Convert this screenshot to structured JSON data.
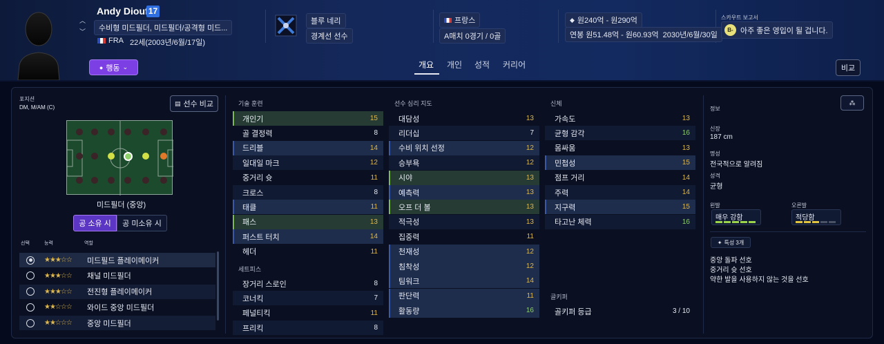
{
  "player": {
    "name": "Andy Diouf",
    "number": "17",
    "positions_desc": "수비형 미드필더, 미드필더/공격형 미드...",
    "nation_code": "FRA",
    "age_birth": "22세(2003년/6월/17일)",
    "action_button": "행동"
  },
  "club": {
    "name": "블루 네리",
    "status": "경계선 선수"
  },
  "nation": {
    "name": "프랑스",
    "caps": "A매치 0경기 / 0골"
  },
  "value": {
    "transfer": "원240억 - 원290억",
    "contract": "연봉 원51.48억 - 원60.93억",
    "contract_end": "2030년/6월/30일"
  },
  "scout": {
    "title": "스카우트 보고서",
    "grade": "B-",
    "text": "아주 좋은 영입이 될 겁니다."
  },
  "tabs": [
    "개요",
    "개인",
    "성적",
    "커리어"
  ],
  "compare_button": "비교",
  "left": {
    "position_label": "포지션",
    "position_value": "DM, M/AM (C)",
    "compare_player_button": "선수 비교",
    "role_name": "미드필더 (중앙)",
    "toggle_on": "공 소유 시",
    "toggle_off": "공 미소유 시",
    "col_select": "선택",
    "col_ability": "능력",
    "col_role": "역할",
    "roles": [
      {
        "name": "미드필드 플레이메이커",
        "stars": "★★★☆☆",
        "selected": true
      },
      {
        "name": "채널 미드필더",
        "stars": "★★★☆☆",
        "selected": false
      },
      {
        "name": "전진형 플레이메이커",
        "stars": "★★★☆☆",
        "selected": false
      },
      {
        "name": "와이드 중앙 미드필더",
        "stars": "★★☆☆☆",
        "selected": false
      },
      {
        "name": "중앙 미드필더",
        "stars": "★★☆☆☆",
        "selected": false
      }
    ]
  },
  "technical": {
    "title": "기술 훈련",
    "attrs": [
      {
        "name": "개인기",
        "value": "15",
        "color": "y",
        "style": "g"
      },
      {
        "name": "골 결정력",
        "value": "8",
        "color": "w",
        "style": ""
      },
      {
        "name": "드리블",
        "value": "14",
        "color": "y",
        "style": "hl"
      },
      {
        "name": "일대일 마크",
        "value": "12",
        "color": "y",
        "style": "alt"
      },
      {
        "name": "중거리 슛",
        "value": "11",
        "color": "y",
        "style": ""
      },
      {
        "name": "크로스",
        "value": "8",
        "color": "w",
        "style": "alt"
      },
      {
        "name": "태클",
        "value": "11",
        "color": "y",
        "style": "hl"
      },
      {
        "name": "패스",
        "value": "13",
        "color": "y",
        "style": "g"
      },
      {
        "name": "퍼스트 터치",
        "value": "14",
        "color": "y",
        "style": "hl"
      },
      {
        "name": "헤더",
        "value": "11",
        "color": "y",
        "style": ""
      }
    ]
  },
  "setpieces": {
    "title": "세트피스",
    "attrs": [
      {
        "name": "장거리 스로인",
        "value": "8",
        "color": "w",
        "style": ""
      },
      {
        "name": "코너킥",
        "value": "7",
        "color": "w",
        "style": "alt"
      },
      {
        "name": "페널티킥",
        "value": "11",
        "color": "y",
        "style": ""
      },
      {
        "name": "프리킥",
        "value": "8",
        "color": "w",
        "style": "alt"
      }
    ]
  },
  "mental": {
    "title": "선수 심리 지도",
    "attrs": [
      {
        "name": "대담성",
        "value": "13",
        "color": "y",
        "style": ""
      },
      {
        "name": "리더십",
        "value": "7",
        "color": "w",
        "style": "alt"
      },
      {
        "name": "수비 위치 선정",
        "value": "12",
        "color": "y",
        "style": "hl"
      },
      {
        "name": "승부욕",
        "value": "12",
        "color": "y",
        "style": "alt"
      },
      {
        "name": "시야",
        "value": "13",
        "color": "y",
        "style": "g"
      },
      {
        "name": "예측력",
        "value": "13",
        "color": "y",
        "style": "hl"
      },
      {
        "name": "오프 더 볼",
        "value": "13",
        "color": "y",
        "style": "g"
      },
      {
        "name": "적극성",
        "value": "13",
        "color": "y",
        "style": "alt"
      },
      {
        "name": "집중력",
        "value": "11",
        "color": "y",
        "style": ""
      },
      {
        "name": "천재성",
        "value": "12",
        "color": "y",
        "style": "hl"
      },
      {
        "name": "침착성",
        "value": "12",
        "color": "y",
        "style": "hl"
      },
      {
        "name": "팀워크",
        "value": "14",
        "color": "y",
        "style": "hl"
      },
      {
        "name": "판단력",
        "value": "11",
        "color": "y",
        "style": "hl"
      },
      {
        "name": "활동량",
        "value": "16",
        "color": "g",
        "style": "hl"
      }
    ]
  },
  "physical": {
    "title": "신체",
    "attrs": [
      {
        "name": "가속도",
        "value": "13",
        "color": "y",
        "style": ""
      },
      {
        "name": "균형 감각",
        "value": "16",
        "color": "g",
        "style": "alt"
      },
      {
        "name": "몸싸움",
        "value": "13",
        "color": "y",
        "style": ""
      },
      {
        "name": "민첩성",
        "value": "15",
        "color": "y",
        "style": "hl"
      },
      {
        "name": "점프 거리",
        "value": "14",
        "color": "y",
        "style": ""
      },
      {
        "name": "주력",
        "value": "14",
        "color": "y",
        "style": "alt"
      },
      {
        "name": "지구력",
        "value": "15",
        "color": "y",
        "style": "hl"
      },
      {
        "name": "타고난 체력",
        "value": "16",
        "color": "g",
        "style": "alt"
      }
    ]
  },
  "goalkeeper": {
    "title": "골키퍼",
    "rating_label": "골키퍼 등급",
    "rating_value": "3 / 10"
  },
  "info": {
    "title": "정보",
    "height_label": "신장",
    "height": "187 cm",
    "rep_label": "명성",
    "rep": "전국적으로 알려짐",
    "personality_label": "성격",
    "personality": "균형",
    "left_foot_label": "왼발",
    "left_foot": "매우 강함",
    "right_foot_label": "오른발",
    "right_foot": "적당함",
    "traits_button": "특성 3개",
    "traits": [
      "중앙 돌파 선호",
      "중거리 슛 선호",
      "약한 발을 사용하지 않는 것을 선호"
    ]
  },
  "colors": {
    "accent_purple": "#7b3fe4",
    "bg_header": "#14285a",
    "value_yellow": "#e0b84a",
    "value_green": "#8ed06a",
    "pitch_green": "#1c4a2c"
  }
}
